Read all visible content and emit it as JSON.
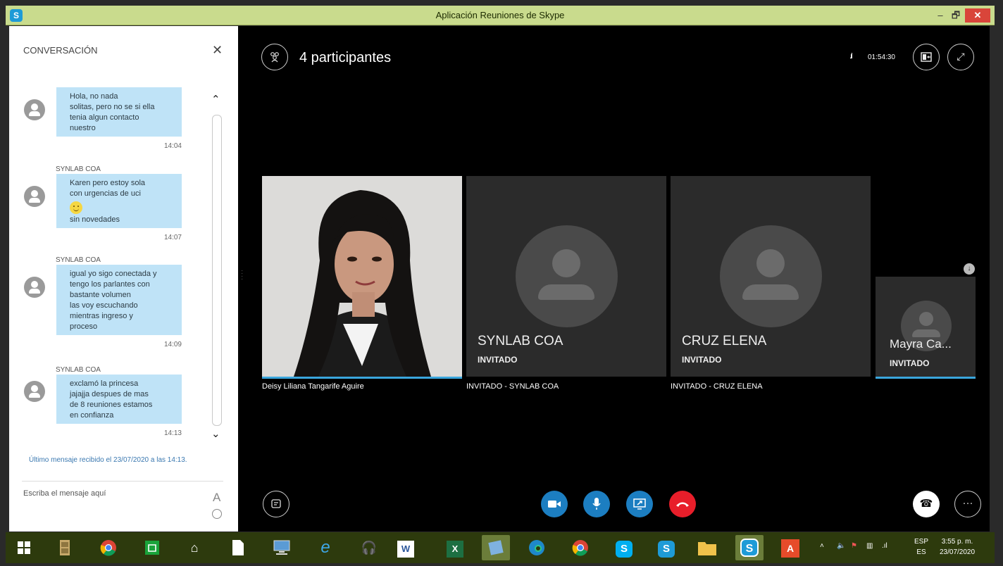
{
  "window": {
    "title": "Aplicación Reuniones de Skype",
    "min": "–",
    "max": "🗗",
    "close": "✕"
  },
  "conversation": {
    "header": "CONVERSACIÓN",
    "close": "✕",
    "messages": [
      {
        "sender": "",
        "lines": [
          "Hola, no nada",
          "solitas, pero no se si ella",
          "tenia algun contacto",
          "nuestro"
        ],
        "time": "14:04"
      },
      {
        "sender": "SYNLAB COA",
        "lines": [
          "Karen pero estoy sola",
          "con urgencias de uci"
        ],
        "emoji": "smile",
        "lines_after": [
          "sin novedades"
        ],
        "time": "14:07"
      },
      {
        "sender": "SYNLAB COA",
        "lines": [
          "igual yo sigo conectada y",
          "tengo los parlantes con",
          "bastante volumen",
          "las voy escuchando",
          "mientras ingreso y",
          "proceso"
        ],
        "time": "14:09"
      },
      {
        "sender": "SYNLAB COA",
        "lines": [
          "exclamó la princesa",
          "jajajja despues de mas",
          "de 8 reuniones estamos",
          "en confianza"
        ],
        "time": "14:13"
      }
    ],
    "last_message": "Último mensaje recibido el 23/07/2020 a las 14:13.",
    "compose_placeholder": "Escriba el mensaje aquí",
    "font_button": "A"
  },
  "meeting": {
    "participants_label": "4 participantes",
    "duration": "01:54:30",
    "tiles": [
      {
        "name": "",
        "role": "",
        "caption": "Deisy Liliana Tangarife Aguire"
      },
      {
        "name": "SYNLAB COA",
        "role": "INVITADO",
        "caption": "INVITADO - SYNLAB COA"
      },
      {
        "name": "CRUZ ELENA",
        "role": "INVITADO",
        "caption": "INVITADO - CRUZ ELENA"
      },
      {
        "name": "Mayra Ca...",
        "role": "INVITADO",
        "caption": ""
      }
    ]
  },
  "taskbar": {
    "apps": [
      "start",
      "files",
      "chrome",
      "store",
      "home",
      "doc",
      "monitor",
      "ie",
      "headphones",
      "word",
      "excel",
      "notepad",
      "edge",
      "chrome2",
      "skype-s",
      "skype-bus",
      "explorer",
      "skype-active",
      "acrobat"
    ],
    "word_label": "W",
    "excel_label": "X",
    "language_top": "ESP",
    "language_bottom": "ES",
    "time": "3:55 p. m.",
    "date": "23/07/2020"
  }
}
